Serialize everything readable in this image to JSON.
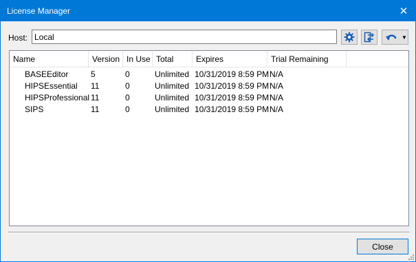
{
  "window": {
    "title": "License Manager",
    "close_glyph": "✕"
  },
  "host": {
    "label": "Host:",
    "value": "Local"
  },
  "toolbar": {
    "buttons": [
      {
        "icon": "settings-gear-icon"
      },
      {
        "icon": "connect-icon"
      },
      {
        "icon": "undo-dropdown-icon"
      }
    ]
  },
  "table": {
    "columns": [
      "Name",
      "Version",
      "In Use",
      "Total",
      "Expires",
      "Trial Remaining"
    ],
    "rows": [
      [
        "BASEEditor",
        "5",
        "0",
        "Unlimited",
        "10/31/2019 8:59 PM",
        "N/A"
      ],
      [
        "HIPSEssential",
        "11",
        "0",
        "Unlimited",
        "10/31/2019 8:59 PM",
        "N/A"
      ],
      [
        "HIPSProfessional",
        "11",
        "0",
        "Unlimited",
        "10/31/2019 8:59 PM",
        "N/A"
      ],
      [
        "SIPS",
        "11",
        "0",
        "Unlimited",
        "10/31/2019 8:59 PM",
        "N/A"
      ]
    ]
  },
  "footer": {
    "close_label": "Close"
  },
  "colors": {
    "accent": "#0078d7",
    "icon_blue": "#1a5fb4"
  }
}
